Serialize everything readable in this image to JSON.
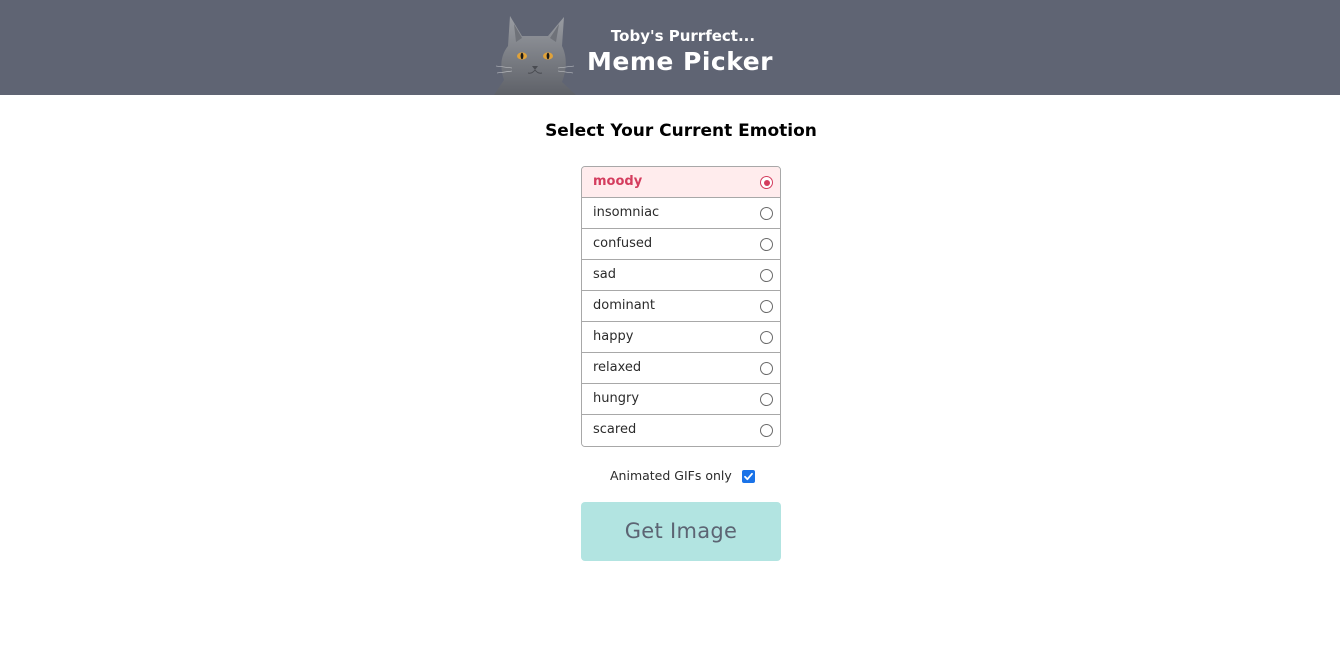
{
  "header": {
    "subtitle": "Toby's Purrfect...",
    "title": "Meme Picker",
    "logo_icon": "cat-icon",
    "background_color": "#5f6473"
  },
  "main": {
    "heading": "Select Your Current Emotion",
    "emotions": [
      {
        "label": "moody",
        "selected": true
      },
      {
        "label": "insomniac",
        "selected": false
      },
      {
        "label": "confused",
        "selected": false
      },
      {
        "label": "sad",
        "selected": false
      },
      {
        "label": "dominant",
        "selected": false
      },
      {
        "label": "happy",
        "selected": false
      },
      {
        "label": "relaxed",
        "selected": false
      },
      {
        "label": "hungry",
        "selected": false
      },
      {
        "label": "scared",
        "selected": false
      }
    ],
    "selected_color": "#d43d5e",
    "selected_background": "#ffeced",
    "gif_option": {
      "label": "Animated GIFs only",
      "checked": true
    },
    "button": {
      "label": "Get Image",
      "background_color": "#b2e4e1"
    }
  }
}
